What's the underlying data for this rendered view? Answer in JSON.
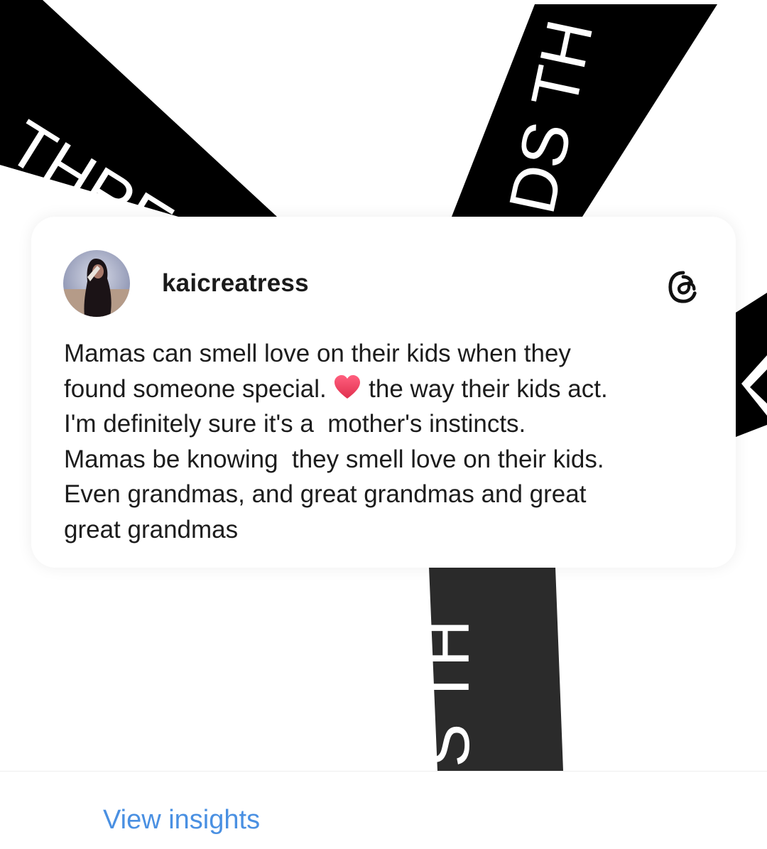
{
  "background": {
    "band_text_1": "THRE",
    "band_text_2": "DS TH",
    "band_text_3": "S TH",
    "band_color": "#000000"
  },
  "post": {
    "username": "kaicreatress",
    "text_line_1": "Mamas can smell love on their kids when they",
    "text_line_2a": "found someone special. ",
    "text_line_2b": " the way their kids act.",
    "text_line_3": "I'm definitely sure it's a  mother's instincts.",
    "text_line_4": "Mamas be knowing  they smell love on their kids.",
    "text_line_5": "Even grandmas, and great grandmas and great",
    "text_line_6": "great grandmas",
    "emoji": "heart",
    "logo_icon": "threads-logo-icon"
  },
  "footer": {
    "view_insights_label": "View insights",
    "link_color": "#4a90e2"
  }
}
